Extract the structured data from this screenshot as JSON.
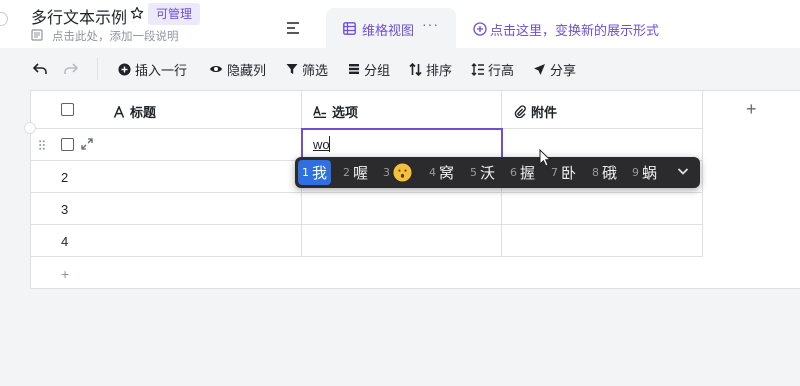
{
  "header": {
    "title": "多行文本示例",
    "manage_badge": "可管理",
    "description_placeholder": "点击此处，添加一段说明",
    "view_tab_label": "维格视图",
    "view_tab_more": "···",
    "add_view_label": "点击这里，变换新的展示形式"
  },
  "toolbar": {
    "insert_row": "插入一行",
    "hide_columns": "隐藏列",
    "filter": "筛选",
    "group": "分组",
    "sort": "排序",
    "row_height": "行高",
    "share": "分享"
  },
  "grid": {
    "columns": [
      {
        "label": "标题",
        "icon": "text-field-icon"
      },
      {
        "label": "选项",
        "icon": "option-field-icon"
      },
      {
        "label": "附件",
        "icon": "paperclip-icon"
      }
    ],
    "add_column": "+",
    "row_numbers": [
      "2",
      "3",
      "4"
    ],
    "add_row": "+",
    "editing_value": "wo"
  },
  "ime": {
    "candidates": [
      {
        "num": "1",
        "text": "我",
        "selected": true
      },
      {
        "num": "2",
        "text": "喔"
      },
      {
        "num": "3",
        "text": "",
        "emoji": "hushed-face"
      },
      {
        "num": "4",
        "text": "窝"
      },
      {
        "num": "5",
        "text": "沃"
      },
      {
        "num": "6",
        "text": "握"
      },
      {
        "num": "7",
        "text": "卧"
      },
      {
        "num": "8",
        "text": "硪"
      },
      {
        "num": "9",
        "text": "蜗"
      }
    ]
  },
  "colors": {
    "accent": "#6d4fd8",
    "ime_selected": "#2f6fe0"
  }
}
